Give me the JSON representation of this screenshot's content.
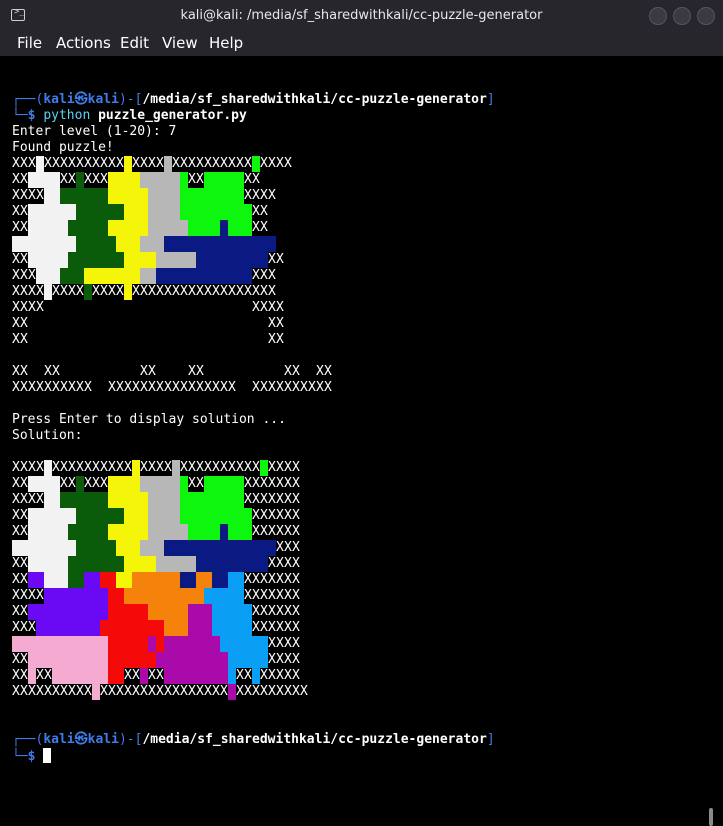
{
  "window": {
    "title": "kali@kali: /media/sf_sharedwithkali/cc-puzzle-generator"
  },
  "menu": [
    "File",
    "Actions",
    "Edit",
    "View",
    "Help"
  ],
  "prompt": {
    "user": "kali",
    "at": "㉿",
    "host": "kali",
    "path": "/media/sf_sharedwithkali/cc-puzzle-generator",
    "top_prefix": "┌──(",
    "top_mid": ")-[",
    "top_suffix": "]",
    "bottom_prefix": "└─",
    "symbol": "$"
  },
  "command": {
    "program": "python",
    "arg": "puzzle_generator.py"
  },
  "output": {
    "level_prompt": "Enter level (1-20): 7",
    "found": "Found puzzle!",
    "press_enter": "Press Enter to display solution ...",
    "solution_label": "Solution:"
  },
  "colors": {
    "W": "#f2f2f2",
    "G": "#0a5c0a",
    "Y": "#f5f50a",
    "S": "#b7b7b7",
    "L": "#0ef50e",
    "N": "#0a1a82",
    "P": "#6a0af5",
    "R": "#f50a0a",
    "O": "#f5820a",
    "B": "#0a9ef5",
    "K": "#f5aad2",
    "M": "#aa0aaa"
  },
  "puzzle_grid": [
    "XXXWXXXXXXXXXXYXXXXSXXXXXXXXXXLXXXX.",
    "XXWWWWXXGXXXYYYYSSSSSLXXLLLLLXX.....",
    "XXXXWWGGGGGGYYYYYSSSSLLLLLLLLXXXX...",
    "XXWWWWWWGGGGGGYYYSSSSLLLLLLLLLXX....",
    "XXWWWWWGGGGGYYYYYSSSSSLLLLNLLLXX....",
    "WWWWWWWWGGGGGYYYSSSNNNNNNNNNNNNNN...",
    "XXWWWWWGGGGGGGYYYYSSSSSNNNNNNNNNXX..",
    "XXXWWWGGGYYYYYYYSSNNNNNNNNNNNNXXX...",
    "XXXXWXXXXGXXXXYXXXXXXXXXXXXXXXXXX...",
    "XXXX..........................XXXX..",
    "XX..............................XX..",
    "XX..............................XX..",
    "....................................",
    "XX..XX..........XX....XX..........XX..XX",
    "XXXXXXXXXX..XXXXXXXXXXXXXXXX..XXXXXXXXXX"
  ],
  "solution_grid": [
    "XXXXWXXXXXXXXXXYXXXXSXXXXXXXXXXLXXXX",
    "XXWWWWXXGXXXYYYYSSSSSLXXLLLLLXXXXXXX",
    "XXXXWWGGGGGGYYYYYSSSSLLLLLLLLXXXXXXX",
    "XXWWWWWWGGGGGGYYYSSSSLLLLLLLLLXXXXXX",
    "XXWWWWWGGGGGYYYYYSSSSSLLLLNLLLXXXXXX",
    "WWWWWWWWGGGGGYYYSSSNNNNNNNNNNNNNNXXX",
    "XXWWWWWGGGGGGGYYYYSSSSSNNNNNNNNNXXXX",
    "XXPPWWWGGPPRRYYOOOOOONNOONNBBXXXXXXX",
    "XXXXPPPPPPPPRROOOOOOOOOOBBBBBXXXXXXX",
    "XXPPPPPPPPPPRRRRROOOOOMMMBBBBBXXXXXX",
    "XXXPPPPPPPPRRRRRRRROOOMMMBBBBBXXXXXX",
    "KKKKKKKKKKKKRRRRRMRMMMMMMMBBBBBBXXXX",
    "XXKKKKKKKKKKRRRRRRMMMMMMMMMBBBBBXXXX",
    "XXKXXKKKKKKKRRXXMXXMMMMMMMMBXXBXXXXX",
    "XXXXXXXXXXKXXXXXXXXXXXXXXXXMXXXXXXXXX"
  ]
}
